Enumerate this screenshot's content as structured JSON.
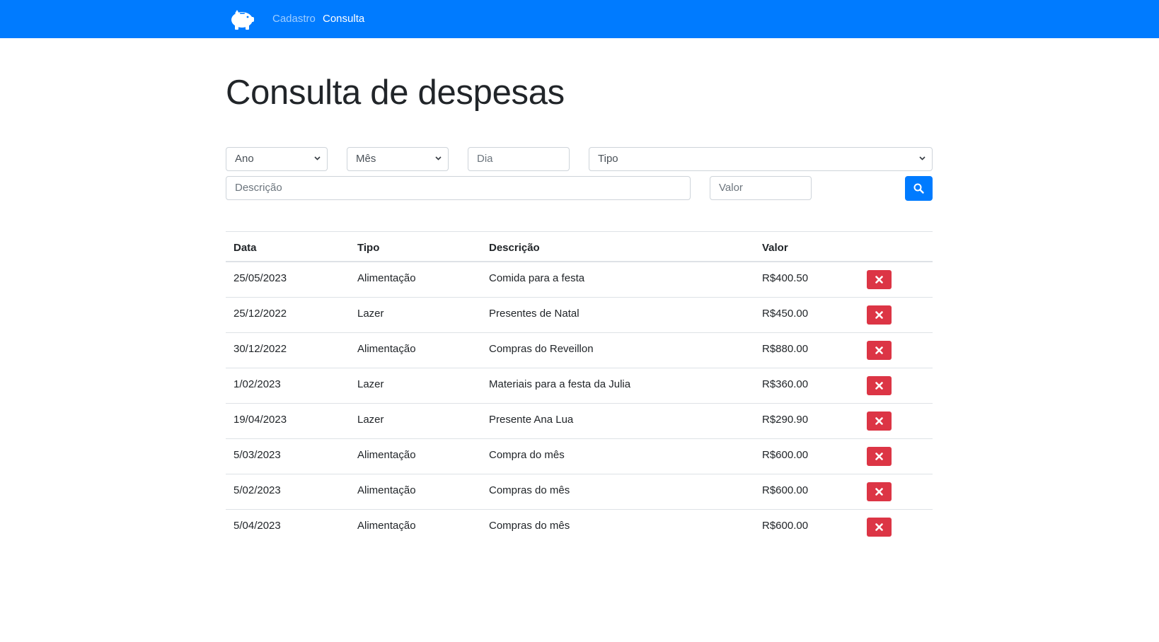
{
  "nav": {
    "brand_icon": "piggy-bank-icon",
    "links": [
      {
        "label": "Cadastro",
        "active": false
      },
      {
        "label": "Consulta",
        "active": true
      }
    ]
  },
  "page": {
    "title": "Consulta de despesas"
  },
  "filters": {
    "ano": {
      "value": "Ano",
      "icon": "chevron-down-icon"
    },
    "mes": {
      "value": "Mês",
      "icon": "chevron-down-icon"
    },
    "dia": {
      "placeholder": "Dia"
    },
    "tipo": {
      "value": "Tipo",
      "icon": "chevron-down-icon"
    },
    "descricao": {
      "placeholder": "Descrição"
    },
    "valor": {
      "placeholder": "Valor"
    },
    "search_icon": "search-icon"
  },
  "table": {
    "headers": [
      "Data",
      "Tipo",
      "Descrição",
      "Valor"
    ],
    "rows": [
      {
        "data": "25/05/2023",
        "tipo": "Alimentação",
        "descricao": "Comida para a festa",
        "valor": "R$400.50"
      },
      {
        "data": "25/12/2022",
        "tipo": "Lazer",
        "descricao": "Presentes de Natal",
        "valor": "R$450.00"
      },
      {
        "data": "30/12/2022",
        "tipo": "Alimentação",
        "descricao": "Compras do Reveillon",
        "valor": "R$880.00"
      },
      {
        "data": "1/02/2023",
        "tipo": "Lazer",
        "descricao": "Materiais para a festa da Julia",
        "valor": "R$360.00"
      },
      {
        "data": "19/04/2023",
        "tipo": "Lazer",
        "descricao": "Presente Ana Lua",
        "valor": "R$290.90"
      },
      {
        "data": "5/03/2023",
        "tipo": "Alimentação",
        "descricao": "Compra do mês",
        "valor": "R$600.00"
      },
      {
        "data": "5/02/2023",
        "tipo": "Alimentação",
        "descricao": "Compras do mês",
        "valor": "R$600.00"
      },
      {
        "data": "5/04/2023",
        "tipo": "Alimentação",
        "descricao": "Compras do mês",
        "valor": "R$600.00"
      }
    ],
    "delete_icon": "close-icon"
  },
  "colors": {
    "primary": "#007bff",
    "danger": "#dc3545",
    "border": "#dee2e6"
  }
}
